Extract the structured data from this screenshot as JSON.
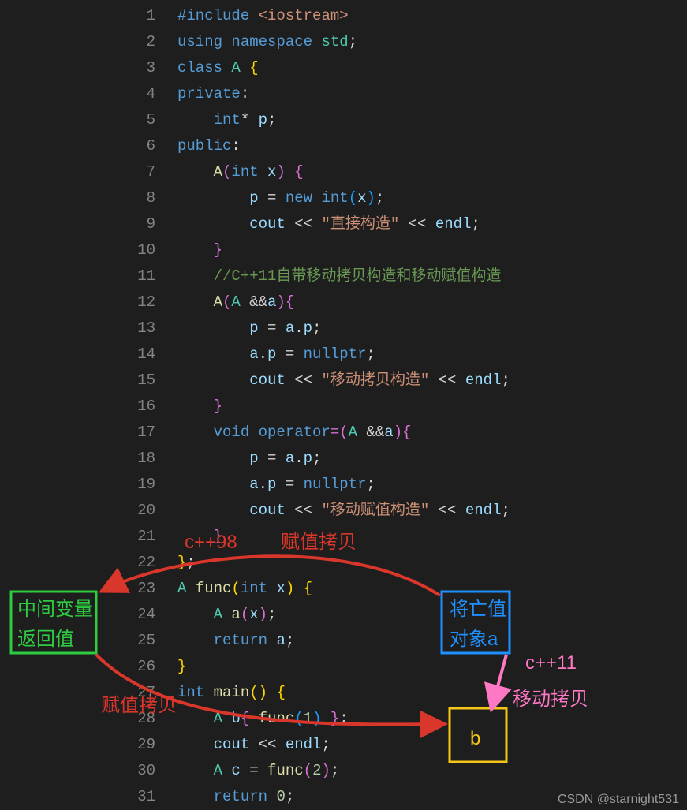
{
  "code": {
    "lines": [
      {
        "num": "1",
        "tokens": [
          {
            "t": "#include",
            "c": "kw"
          },
          {
            "t": " ",
            "c": "op"
          },
          {
            "t": "<iostream>",
            "c": "str"
          }
        ]
      },
      {
        "num": "2",
        "tokens": [
          {
            "t": "using",
            "c": "kw"
          },
          {
            "t": " ",
            "c": "op"
          },
          {
            "t": "namespace",
            "c": "kw"
          },
          {
            "t": " ",
            "c": "op"
          },
          {
            "t": "std",
            "c": "type"
          },
          {
            "t": ";",
            "c": "pun"
          }
        ]
      },
      {
        "num": "3",
        "tokens": [
          {
            "t": "class",
            "c": "kw"
          },
          {
            "t": " ",
            "c": "op"
          },
          {
            "t": "A",
            "c": "type"
          },
          {
            "t": " ",
            "c": "op"
          },
          {
            "t": "{",
            "c": "brace"
          }
        ]
      },
      {
        "num": "4",
        "tokens": [
          {
            "t": "private",
            "c": "kw"
          },
          {
            "t": ":",
            "c": "pun"
          }
        ]
      },
      {
        "num": "5",
        "tokens": [
          {
            "t": "    ",
            "c": "op"
          },
          {
            "t": "int",
            "c": "kw"
          },
          {
            "t": "* ",
            "c": "op"
          },
          {
            "t": "p",
            "c": "var"
          },
          {
            "t": ";",
            "c": "pun"
          }
        ]
      },
      {
        "num": "6",
        "tokens": [
          {
            "t": "public",
            "c": "kw"
          },
          {
            "t": ":",
            "c": "pun"
          }
        ]
      },
      {
        "num": "7",
        "tokens": [
          {
            "t": "    ",
            "c": "op"
          },
          {
            "t": "A",
            "c": "fn"
          },
          {
            "t": "(",
            "c": "brace2"
          },
          {
            "t": "int",
            "c": "kw"
          },
          {
            "t": " ",
            "c": "op"
          },
          {
            "t": "x",
            "c": "var"
          },
          {
            "t": ") ",
            "c": "brace2"
          },
          {
            "t": "{",
            "c": "brace2"
          }
        ]
      },
      {
        "num": "8",
        "tokens": [
          {
            "t": "        ",
            "c": "op"
          },
          {
            "t": "p",
            "c": "var"
          },
          {
            "t": " = ",
            "c": "op"
          },
          {
            "t": "new",
            "c": "kw"
          },
          {
            "t": " ",
            "c": "op"
          },
          {
            "t": "int",
            "c": "kw"
          },
          {
            "t": "(",
            "c": "brace3"
          },
          {
            "t": "x",
            "c": "var"
          },
          {
            "t": ")",
            "c": "brace3"
          },
          {
            "t": ";",
            "c": "pun"
          }
        ]
      },
      {
        "num": "9",
        "tokens": [
          {
            "t": "        ",
            "c": "op"
          },
          {
            "t": "cout",
            "c": "var"
          },
          {
            "t": " << ",
            "c": "op"
          },
          {
            "t": "\"直接构造\"",
            "c": "str"
          },
          {
            "t": " << ",
            "c": "op"
          },
          {
            "t": "endl",
            "c": "var"
          },
          {
            "t": ";",
            "c": "pun"
          }
        ]
      },
      {
        "num": "10",
        "tokens": [
          {
            "t": "    ",
            "c": "op"
          },
          {
            "t": "}",
            "c": "brace2"
          }
        ]
      },
      {
        "num": "11",
        "tokens": [
          {
            "t": "    ",
            "c": "op"
          },
          {
            "t": "//C++11自带移动拷贝构造和移动赋值构造",
            "c": "cmt"
          }
        ]
      },
      {
        "num": "12",
        "tokens": [
          {
            "t": "    ",
            "c": "op"
          },
          {
            "t": "A",
            "c": "fn"
          },
          {
            "t": "(",
            "c": "brace2"
          },
          {
            "t": "A",
            "c": "type"
          },
          {
            "t": " &&",
            "c": "op"
          },
          {
            "t": "a",
            "c": "var"
          },
          {
            "t": ")",
            "c": "brace2"
          },
          {
            "t": "{",
            "c": "brace2"
          }
        ]
      },
      {
        "num": "13",
        "tokens": [
          {
            "t": "        ",
            "c": "op"
          },
          {
            "t": "p",
            "c": "var"
          },
          {
            "t": " = ",
            "c": "op"
          },
          {
            "t": "a",
            "c": "var"
          },
          {
            "t": ".",
            "c": "op"
          },
          {
            "t": "p",
            "c": "var"
          },
          {
            "t": ";",
            "c": "pun"
          }
        ]
      },
      {
        "num": "14",
        "tokens": [
          {
            "t": "        ",
            "c": "op"
          },
          {
            "t": "a",
            "c": "var"
          },
          {
            "t": ".",
            "c": "op"
          },
          {
            "t": "p",
            "c": "var"
          },
          {
            "t": " = ",
            "c": "op"
          },
          {
            "t": "nullptr",
            "c": "kw"
          },
          {
            "t": ";",
            "c": "pun"
          }
        ]
      },
      {
        "num": "15",
        "tokens": [
          {
            "t": "        ",
            "c": "op"
          },
          {
            "t": "cout",
            "c": "var"
          },
          {
            "t": " << ",
            "c": "op"
          },
          {
            "t": "\"移动拷贝构造\"",
            "c": "str"
          },
          {
            "t": " << ",
            "c": "op"
          },
          {
            "t": "endl",
            "c": "var"
          },
          {
            "t": ";",
            "c": "pun"
          }
        ]
      },
      {
        "num": "16",
        "tokens": [
          {
            "t": "    ",
            "c": "op"
          },
          {
            "t": "}",
            "c": "brace2"
          }
        ]
      },
      {
        "num": "17",
        "tokens": [
          {
            "t": "    ",
            "c": "op"
          },
          {
            "t": "void",
            "c": "kw"
          },
          {
            "t": " ",
            "c": "op"
          },
          {
            "t": "operator",
            "c": "kw"
          },
          {
            "t": "=(",
            "c": "brace2"
          },
          {
            "t": "A",
            "c": "type"
          },
          {
            "t": " &&",
            "c": "op"
          },
          {
            "t": "a",
            "c": "var"
          },
          {
            "t": ")",
            "c": "brace2"
          },
          {
            "t": "{",
            "c": "brace2"
          }
        ]
      },
      {
        "num": "18",
        "tokens": [
          {
            "t": "        ",
            "c": "op"
          },
          {
            "t": "p",
            "c": "var"
          },
          {
            "t": " = ",
            "c": "op"
          },
          {
            "t": "a",
            "c": "var"
          },
          {
            "t": ".",
            "c": "op"
          },
          {
            "t": "p",
            "c": "var"
          },
          {
            "t": ";",
            "c": "pun"
          }
        ]
      },
      {
        "num": "19",
        "tokens": [
          {
            "t": "        ",
            "c": "op"
          },
          {
            "t": "a",
            "c": "var"
          },
          {
            "t": ".",
            "c": "op"
          },
          {
            "t": "p",
            "c": "var"
          },
          {
            "t": " = ",
            "c": "op"
          },
          {
            "t": "nullptr",
            "c": "kw"
          },
          {
            "t": ";",
            "c": "pun"
          }
        ]
      },
      {
        "num": "20",
        "tokens": [
          {
            "t": "        ",
            "c": "op"
          },
          {
            "t": "cout",
            "c": "var"
          },
          {
            "t": " << ",
            "c": "op"
          },
          {
            "t": "\"移动赋值构造\"",
            "c": "str"
          },
          {
            "t": " << ",
            "c": "op"
          },
          {
            "t": "endl",
            "c": "var"
          },
          {
            "t": ";",
            "c": "pun"
          }
        ]
      },
      {
        "num": "21",
        "tokens": [
          {
            "t": "    ",
            "c": "op"
          },
          {
            "t": "}",
            "c": "brace2"
          }
        ]
      },
      {
        "num": "22",
        "tokens": [
          {
            "t": "}",
            "c": "brace"
          },
          {
            "t": ";",
            "c": "pun"
          }
        ]
      },
      {
        "num": "23",
        "tokens": [
          {
            "t": "A",
            "c": "type"
          },
          {
            "t": " ",
            "c": "op"
          },
          {
            "t": "func",
            "c": "fn"
          },
          {
            "t": "(",
            "c": "brace"
          },
          {
            "t": "int",
            "c": "kw"
          },
          {
            "t": " ",
            "c": "op"
          },
          {
            "t": "x",
            "c": "var"
          },
          {
            "t": ") ",
            "c": "brace"
          },
          {
            "t": "{",
            "c": "brace"
          }
        ]
      },
      {
        "num": "24",
        "tokens": [
          {
            "t": "    ",
            "c": "op"
          },
          {
            "t": "A",
            "c": "type"
          },
          {
            "t": " ",
            "c": "op"
          },
          {
            "t": "a",
            "c": "fn"
          },
          {
            "t": "(",
            "c": "brace2"
          },
          {
            "t": "x",
            "c": "var"
          },
          {
            "t": ")",
            "c": "brace2"
          },
          {
            "t": ";",
            "c": "pun"
          }
        ]
      },
      {
        "num": "25",
        "tokens": [
          {
            "t": "    ",
            "c": "op"
          },
          {
            "t": "return",
            "c": "kw"
          },
          {
            "t": " ",
            "c": "op"
          },
          {
            "t": "a",
            "c": "var"
          },
          {
            "t": ";",
            "c": "pun"
          }
        ]
      },
      {
        "num": "26",
        "tokens": [
          {
            "t": "}",
            "c": "brace"
          }
        ]
      },
      {
        "num": "27",
        "tokens": [
          {
            "t": "int",
            "c": "kw"
          },
          {
            "t": " ",
            "c": "op"
          },
          {
            "t": "main",
            "c": "fn"
          },
          {
            "t": "() ",
            "c": "brace"
          },
          {
            "t": "{",
            "c": "brace"
          }
        ]
      },
      {
        "num": "28",
        "tokens": [
          {
            "t": "    ",
            "c": "op"
          },
          {
            "t": "A",
            "c": "type"
          },
          {
            "t": " ",
            "c": "op"
          },
          {
            "t": "b",
            "c": "var"
          },
          {
            "t": "{ ",
            "c": "brace2"
          },
          {
            "t": "func",
            "c": "fn"
          },
          {
            "t": "(",
            "c": "brace3"
          },
          {
            "t": "1",
            "c": "num"
          },
          {
            "t": ") ",
            "c": "brace3"
          },
          {
            "t": "}",
            "c": "brace2"
          },
          {
            "t": ";",
            "c": "pun"
          }
        ]
      },
      {
        "num": "29",
        "tokens": [
          {
            "t": "    ",
            "c": "op"
          },
          {
            "t": "cout",
            "c": "var"
          },
          {
            "t": " << ",
            "c": "op"
          },
          {
            "t": "endl",
            "c": "var"
          },
          {
            "t": ";",
            "c": "pun"
          }
        ]
      },
      {
        "num": "30",
        "tokens": [
          {
            "t": "    ",
            "c": "op"
          },
          {
            "t": "A",
            "c": "type"
          },
          {
            "t": " ",
            "c": "op"
          },
          {
            "t": "c",
            "c": "var"
          },
          {
            "t": " = ",
            "c": "op"
          },
          {
            "t": "func",
            "c": "fn"
          },
          {
            "t": "(",
            "c": "brace2"
          },
          {
            "t": "2",
            "c": "num"
          },
          {
            "t": ")",
            "c": "brace2"
          },
          {
            "t": ";",
            "c": "pun"
          }
        ]
      },
      {
        "num": "31",
        "tokens": [
          {
            "t": "    ",
            "c": "op"
          },
          {
            "t": "return",
            "c": "kw"
          },
          {
            "t": " ",
            "c": "op"
          },
          {
            "t": "0",
            "c": "num"
          },
          {
            "t": ";",
            "c": "pun"
          }
        ]
      }
    ]
  },
  "annotations": {
    "cpp98_label": "c++98",
    "assign_copy_top": "赋值拷贝",
    "assign_copy_bottom": "赋值拷贝",
    "intermediate_var": "中间变量",
    "return_value": "返回值",
    "dying_value": "将亡值",
    "object_a": "对象a",
    "cpp11_label": "c++11",
    "move_copy": "移动拷贝",
    "b_label": "b"
  },
  "watermark": "CSDN @starnight531"
}
